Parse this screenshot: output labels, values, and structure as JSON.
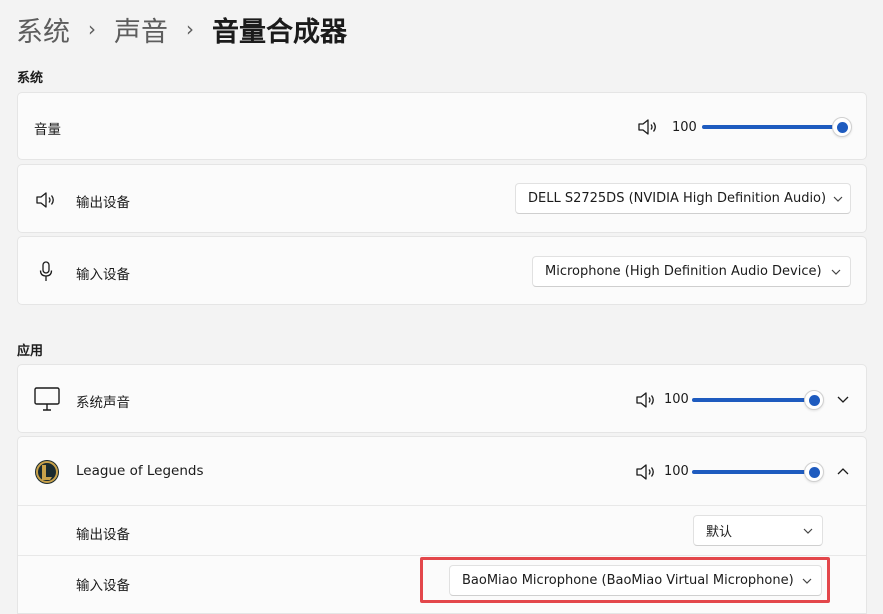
{
  "breadcrumb": {
    "item1": "系统",
    "item2": "声音",
    "current": "音量合成器",
    "separator": "›"
  },
  "system_section": {
    "title": "系统",
    "volume": {
      "label": "音量",
      "value": "100",
      "level_percent": 100
    },
    "output_device": {
      "label": "输出设备",
      "selected": "DELL S2725DS (NVIDIA High Definition Audio)"
    },
    "input_device": {
      "label": "输入设备",
      "selected": "Microphone (High Definition Audio Device)"
    }
  },
  "apps_section": {
    "title": "应用",
    "system_sounds": {
      "label": "系统声音",
      "value": "100",
      "level_percent": 100
    },
    "league": {
      "label": "League of Legends",
      "value": "100",
      "level_percent": 100,
      "output_label": "输出设备",
      "output_selected": "默认",
      "input_label": "输入设备",
      "input_selected": "BaoMiao Microphone (BaoMiao Virtual Microphone)"
    }
  },
  "icons": [
    "speaker-icon",
    "microphone-icon",
    "monitor-icon",
    "league-of-legends-icon",
    "chevron-down-icon",
    "chevron-up-icon"
  ],
  "colors": {
    "accent": "#1e5bbf",
    "highlight": "#e3474b",
    "background": "#f3f3f3",
    "card": "#fbfbfb"
  }
}
